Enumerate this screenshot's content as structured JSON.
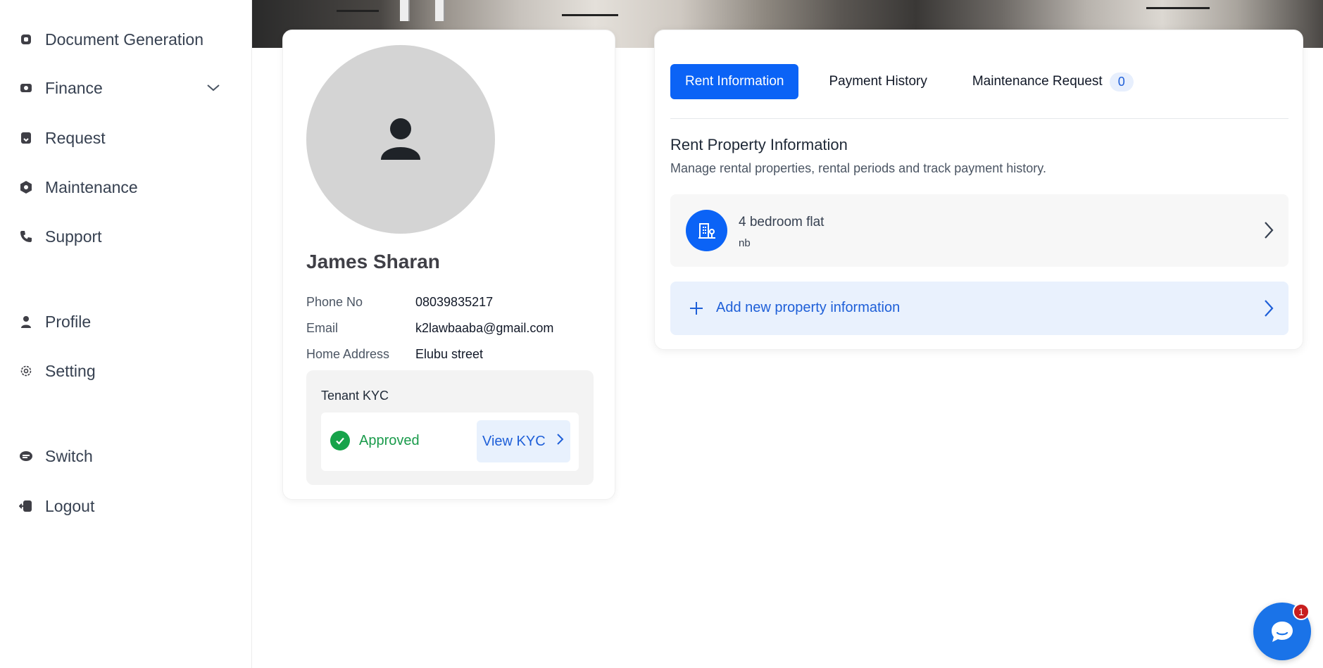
{
  "sidebar": {
    "items": [
      {
        "label": "Document Generation",
        "icon": "document-icon"
      },
      {
        "label": "Finance",
        "icon": "finance-icon"
      },
      {
        "label": "Request",
        "icon": "request-icon"
      },
      {
        "label": "Maintenance",
        "icon": "maintenance-icon"
      },
      {
        "label": "Support",
        "icon": "phone-icon"
      },
      {
        "label": "Profile",
        "icon": "person-icon"
      },
      {
        "label": "Setting",
        "icon": "gear-icon"
      },
      {
        "label": "Switch",
        "icon": "switch-icon"
      },
      {
        "label": "Logout",
        "icon": "logout-icon"
      }
    ]
  },
  "profile": {
    "name": "James Sharan",
    "fields": [
      {
        "label": "Phone No",
        "value": "08039835217"
      },
      {
        "label": "Email",
        "value": "k2lawbaaba@gmail.com"
      },
      {
        "label": "Home Address",
        "value": "Elubu street"
      }
    ],
    "kyc": {
      "title": "Tenant KYC",
      "status": "Approved",
      "view_label": "View KYC"
    }
  },
  "rent": {
    "tabs": [
      {
        "label": "Rent Information",
        "active": true
      },
      {
        "label": "Payment History",
        "active": false
      },
      {
        "label": "Maintenance Request",
        "active": false,
        "badge": "0"
      }
    ],
    "section_title": "Rent Property Information",
    "section_subtitle": "Manage rental properties, rental periods and track payment history.",
    "property": {
      "name": "4 bedroom flat",
      "subtitle": "nb"
    },
    "add_label": "Add new property information"
  },
  "chat": {
    "badge_count": "1"
  },
  "colors": {
    "primary": "#0b63f6",
    "approved": "#16a34a",
    "badge_red": "#c81e1e"
  }
}
